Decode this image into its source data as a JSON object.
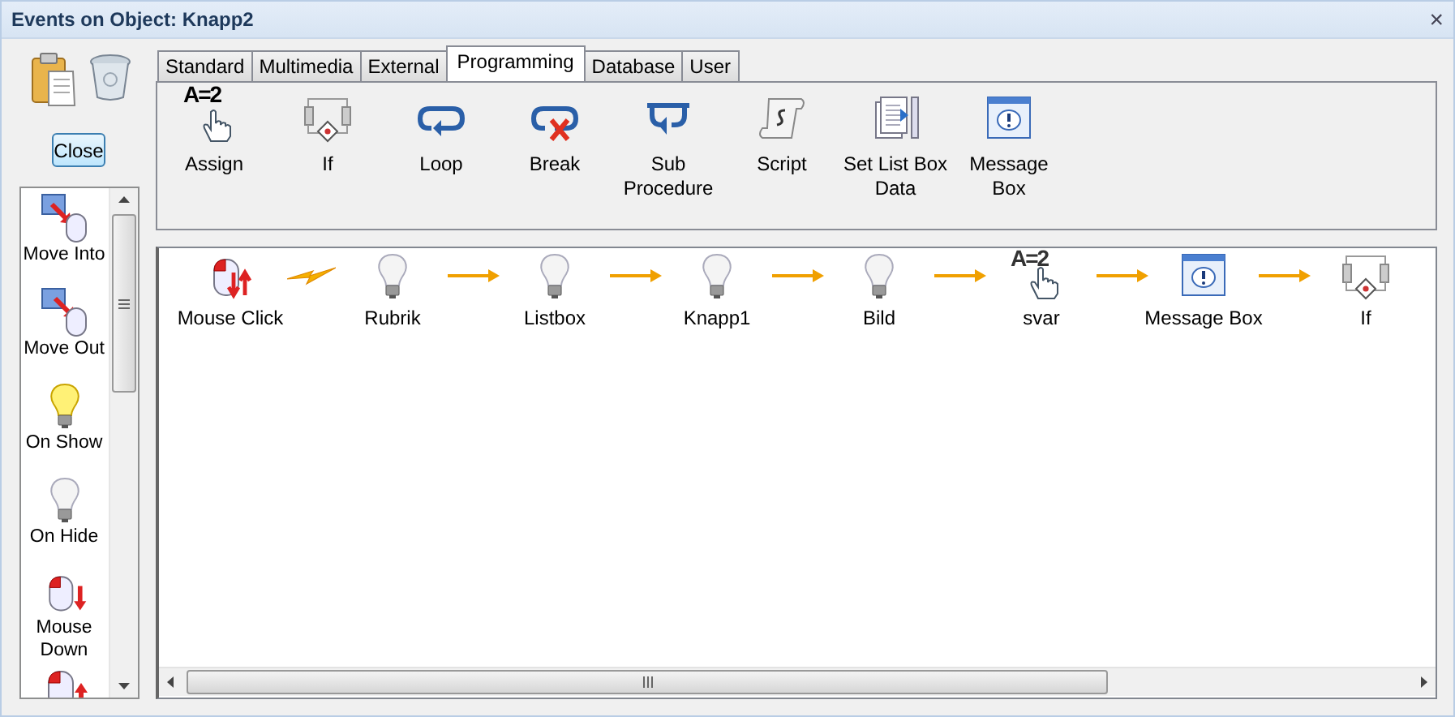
{
  "window": {
    "title": "Events on Object: Knapp2",
    "close": "×"
  },
  "left_buttons": [
    {
      "label": "Close"
    }
  ],
  "events_list": [
    {
      "kind": "move-into",
      "label": "Move Into"
    },
    {
      "kind": "move-out",
      "label": "Move Out"
    },
    {
      "kind": "bulb-on",
      "label": "On Show"
    },
    {
      "kind": "bulb-off",
      "label": "On Hide"
    },
    {
      "kind": "mouse-down",
      "label": "Mouse Down"
    },
    {
      "kind": "mouse-up"
    }
  ],
  "tabs": [
    {
      "label": "Standard",
      "selected": false
    },
    {
      "label": "Multimedia",
      "selected": false
    },
    {
      "label": "External",
      "selected": false
    },
    {
      "label": "Programming",
      "selected": true
    },
    {
      "label": "Database",
      "selected": false
    },
    {
      "label": "User",
      "selected": false
    }
  ],
  "toolbar": [
    {
      "kind": "assign",
      "glyph": "A=2",
      "label": "Assign"
    },
    {
      "kind": "if",
      "label": "If"
    },
    {
      "kind": "loop",
      "label": "Loop"
    },
    {
      "kind": "break",
      "label": "Break"
    },
    {
      "kind": "sub",
      "label": "Sub Procedure"
    },
    {
      "kind": "script",
      "label": "Script"
    },
    {
      "kind": "listdata",
      "label": "Set List Box Data"
    },
    {
      "kind": "msgbox",
      "label": "Message Box"
    }
  ],
  "flow": [
    {
      "kind": "mouse-click",
      "label": "Mouse Click"
    },
    {
      "kind": "bulb-off",
      "label": "Rubrik"
    },
    {
      "kind": "bulb-off",
      "label": "Listbox"
    },
    {
      "kind": "bulb-off",
      "label": "Knapp1"
    },
    {
      "kind": "bulb-off",
      "label": "Bild"
    },
    {
      "kind": "assign",
      "glyph": "A=2",
      "label": "svar"
    },
    {
      "kind": "msgbox",
      "label": "Message Box"
    },
    {
      "kind": "if",
      "label": "If"
    }
  ],
  "connectors": [
    {
      "kind": "lightning"
    },
    {
      "kind": "arrow"
    },
    {
      "kind": "arrow"
    },
    {
      "kind": "arrow"
    },
    {
      "kind": "arrow"
    },
    {
      "kind": "arrow"
    },
    {
      "kind": "arrow"
    }
  ]
}
